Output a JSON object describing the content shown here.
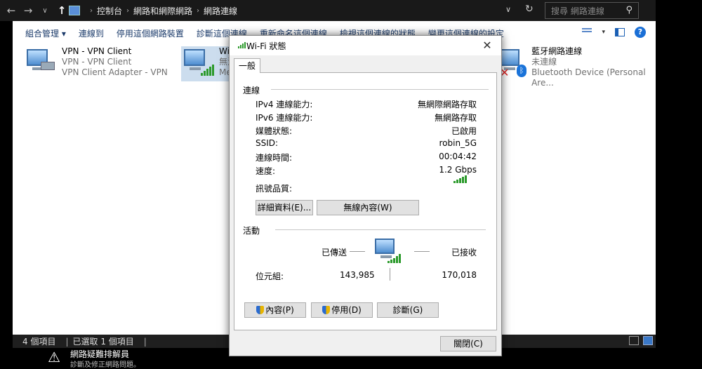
{
  "addressbar": {
    "crumbs": [
      "控制台",
      "網路和網際網路",
      "網路連線"
    ],
    "search_placeholder": "搜尋 網路連線"
  },
  "commandbar": {
    "items": [
      "組合管理 ▾",
      "連線到",
      "停用這個網路裝置",
      "診斷這個連線",
      "重新命名這個連線",
      "檢視這個連線的狀態",
      "變更這個連線的設定"
    ]
  },
  "connections": [
    {
      "name": "VPN - VPN Client",
      "status": "VPN - VPN Client",
      "device": "VPN Client Adapter - VPN"
    },
    {
      "name": "Wi-",
      "status": "無法",
      "device": "Med"
    },
    {
      "name": "藍牙網路連線",
      "status": "未連線",
      "device": "Bluetooth Device (Personal Are..."
    }
  ],
  "statusbar": {
    "items_count": "4 個項目",
    "selected": "已選取 1 個項目"
  },
  "troubleshooter": {
    "title": "網路疑難排解員",
    "subtitle": "診斷及修正網路問題。"
  },
  "dialog": {
    "title": "Wi-Fi 狀態",
    "tab": "一般",
    "connection_group": "連線",
    "rows": [
      {
        "label": "IPv4 連線能力:",
        "value": "無網際網路存取"
      },
      {
        "label": "IPv6 連線能力:",
        "value": "無網路存取"
      },
      {
        "label": "媒體狀態:",
        "value": "已啟用"
      },
      {
        "label": "SSID:",
        "value": "robin_5G"
      },
      {
        "label": "連線時間:",
        "value": "00:04:42"
      },
      {
        "label": "速度:",
        "value": "1.2 Gbps"
      }
    ],
    "signal_label": "訊號品質:",
    "details_button": "詳細資料(E)...",
    "wireless_button": "無線內容(W)",
    "activity_group": "活動",
    "sent_label": "已傳送",
    "received_label": "已接收",
    "bytes_label": "位元組:",
    "bytes_sent": "143,985",
    "bytes_received": "170,018",
    "properties_button": "內容(P)",
    "disable_button": "停用(D)",
    "diagnose_button": "診斷(G)",
    "close_button": "關閉(C)"
  },
  "colors": {
    "signal_green": "#2c9a2c",
    "accent_blue": "#1a6fd6"
  }
}
